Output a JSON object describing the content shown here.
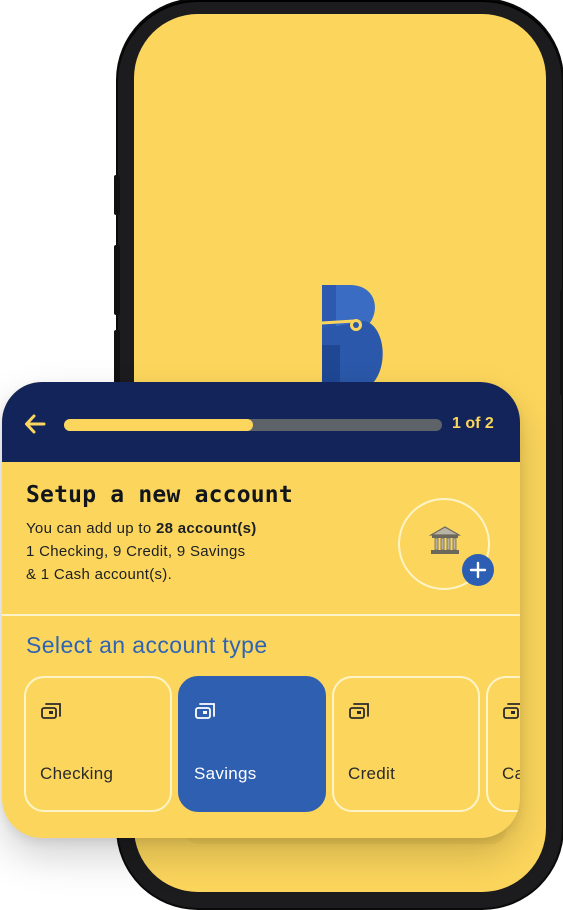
{
  "header": {
    "step_counter": "1 of 2",
    "progress": 0.5
  },
  "setup": {
    "title": "Setup a new account",
    "line1_prefix": "You can add up to ",
    "line1_bold": "28 account(s)",
    "line2": "1 Checking, 9 Credit, 9 Savings",
    "line3": "& 1 Cash account(s)."
  },
  "section": {
    "select_label": "Select an account type"
  },
  "account_types": [
    {
      "label": "Checking",
      "selected": false
    },
    {
      "label": "Savings",
      "selected": true
    },
    {
      "label": "Credit",
      "selected": false
    },
    {
      "label": "Cash",
      "selected": false
    }
  ],
  "icons": {
    "back": "arrow-left-icon",
    "bank": "bank-icon",
    "add": "plus-icon",
    "account": "cards-icon"
  },
  "colors": {
    "brand_yellow": "#fcd65c",
    "header_navy": "#12245a",
    "accent_blue": "#2f5fb0"
  }
}
